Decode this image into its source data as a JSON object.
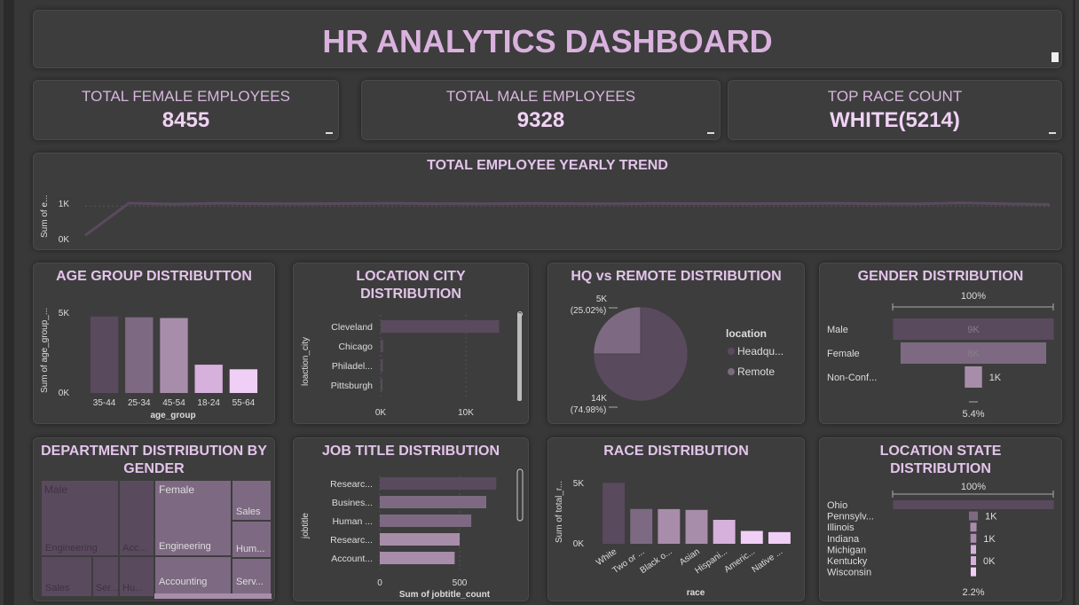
{
  "dashboard": {
    "title": "HR ANALYTICS DASHBOARD"
  },
  "kpis": [
    {
      "label": "TOTAL FEMALE EMPLOYEES",
      "value": "8455"
    },
    {
      "label": "TOTAL MALE EMPLOYEES",
      "value": "9328"
    },
    {
      "label": "TOP RACE COUNT",
      "value": "WHITE(5214)"
    }
  ],
  "colors": {
    "bg": "#383838",
    "card": "#3d3d3d",
    "title": "#e3c4ea",
    "dark": "#5a4a5e",
    "mid": "#7d6a82",
    "light": "#a88daa",
    "pale": "#d5b1dc",
    "palest": "#f0cff6"
  },
  "chart_data": [
    {
      "id": "trend",
      "type": "line",
      "title": "TOTAL EMPLOYEE YEARLY TREND",
      "ylabel": "Sum of e...",
      "yticks": [
        "1K",
        "0K"
      ],
      "ylim": [
        0,
        1200
      ],
      "values": [
        100,
        1090,
        1060,
        1085,
        1075,
        1070,
        1080,
        1085,
        1075,
        1068,
        1080,
        1078,
        1072,
        1080,
        1078,
        1075,
        1078,
        1082,
        1075,
        1070,
        1100,
        1070,
        1050
      ]
    },
    {
      "id": "age",
      "type": "bar",
      "title": "AGE GROUP DISTRIBUTTON",
      "xlabel": "age_group",
      "ylabel": "Sum of age_group_...",
      "yticks": [
        "5K",
        "0K"
      ],
      "ylim": [
        0,
        5800
      ],
      "categories": [
        "35-44",
        "25-34",
        "45-54",
        "18-24",
        "55-64"
      ],
      "values": [
        5000,
        4950,
        4900,
        1850,
        1550
      ]
    },
    {
      "id": "city",
      "type": "bar",
      "title": "LOCATION CITY DISTRIBUTION",
      "ylabel": "loaction_city",
      "xticks": [
        "0K",
        "10K"
      ],
      "xlim": [
        0,
        20000
      ],
      "categories": [
        "Cleveland",
        "Chicago",
        "Philadel...",
        "Pittsburgh"
      ],
      "values": [
        13900,
        300,
        250,
        200
      ]
    },
    {
      "id": "hq",
      "type": "pie",
      "title": "HQ vs REMOTE DISTRIBUTION",
      "legend_title": "location",
      "series": [
        {
          "name": "Headqu...",
          "value": "14K",
          "pct": "(74.98%)",
          "share": 74.98
        },
        {
          "name": "Remote",
          "value": "5K",
          "pct": "(25.02%)",
          "share": 25.02
        }
      ]
    },
    {
      "id": "gender",
      "type": "bar",
      "title": "GENDER DISTRIBUTION",
      "top_label": "100%",
      "bottom_label": "5.4%",
      "categories": [
        "Male",
        "Female",
        "Non-Conf..."
      ],
      "labels": [
        "9K",
        "8K",
        "1K"
      ],
      "values": [
        9328,
        8455,
        1000
      ]
    },
    {
      "id": "dept",
      "type": "heatmap",
      "title": "DEPARTMENT DISTRIBUTION BY GENDER",
      "labels": [
        "Male",
        "Female",
        "Engineering",
        "Acc...",
        "Engineering",
        "Sales",
        "Hum...",
        "Accounting",
        "Serv...",
        "Sales",
        "Ser...",
        "Hu..."
      ]
    },
    {
      "id": "job",
      "type": "bar",
      "title": "JOB TITLE DISTRIBUTION",
      "xlabel": "Sum of jobtitle_count",
      "ylabel": "jobtitle",
      "xticks": [
        "0",
        "500"
      ],
      "xlim": [
        0,
        800
      ],
      "categories": [
        "Researc...",
        "Busines...",
        "Human ...",
        "Researc...",
        "Account..."
      ],
      "values": [
        700,
        640,
        550,
        480,
        450
      ]
    },
    {
      "id": "race",
      "type": "bar",
      "title": "RACE DISTRIBUTION",
      "xlabel": "race",
      "ylabel": "Sum of total_r...",
      "yticks": [
        "5K",
        "0K"
      ],
      "ylim": [
        0,
        6000
      ],
      "categories": [
        "White",
        "Two or ...",
        "Black o...",
        "Asian",
        "Hispani...",
        "Americ...",
        "Native ..."
      ],
      "values": [
        5214,
        2980,
        2970,
        2900,
        2050,
        1100,
        1000
      ]
    },
    {
      "id": "state",
      "type": "bar",
      "title": "LOCATION STATE DISTRIBUTION",
      "top_label": "100%",
      "bottom_label": "2.2%",
      "categories": [
        "Ohio",
        "Pennsylv...",
        "Illinois",
        "Indiana",
        "Michigan",
        "Kentucky",
        "Wisconsin"
      ],
      "labels": [
        "",
        "1K",
        "",
        "1K",
        "",
        "0K",
        ""
      ],
      "values": [
        18000,
        1000,
        700,
        650,
        600,
        450,
        400
      ]
    }
  ]
}
